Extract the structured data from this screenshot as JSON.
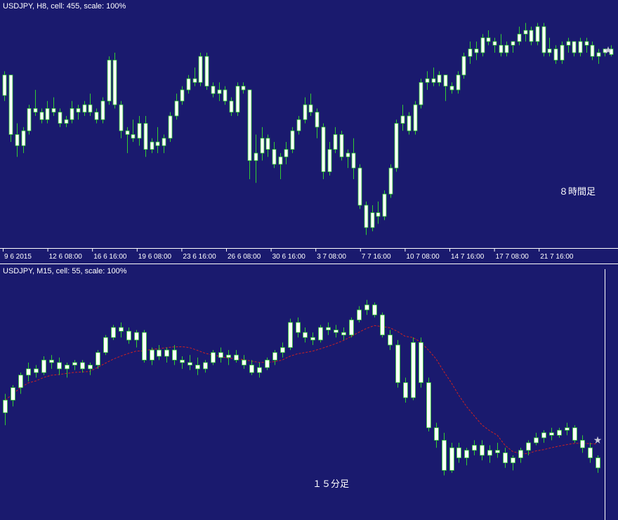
{
  "colors": {
    "background": "#1a1a6e",
    "bull_body": "#ffffff",
    "bear_body": "#ffffff",
    "wick": "#33cc33",
    "separator": "#ffffff",
    "ma_line": "#cc2222",
    "star": "#c8c8d8"
  },
  "icons": {
    "marker": "star-icon"
  },
  "chart_data": [
    {
      "type": "candlestick",
      "header": "USDJPY, H8, cell: 455, scale: 100%",
      "note": "８時間足",
      "x_ticks": [
        "9 6 2015",
        "12 6 08:00",
        "16 6 16:00",
        "19 6 08:00",
        "23 6 16:00",
        "26 6 08:00",
        "30 6 16:00",
        "3 7 08:00",
        "7 7 16:00",
        "10 7 08:00",
        "14 7 16:00",
        "17 7 08:00",
        "21 7 16:00"
      ],
      "ohlc": [
        [
          123.45,
          124.1,
          123.3,
          124.0
        ],
        [
          124.0,
          124.0,
          122.2,
          122.4
        ],
        [
          122.4,
          122.7,
          121.8,
          122.1
        ],
        [
          122.1,
          122.6,
          121.9,
          122.5
        ],
        [
          122.5,
          123.2,
          122.4,
          123.1
        ],
        [
          123.1,
          123.6,
          122.9,
          123.0
        ],
        [
          123.0,
          123.1,
          122.7,
          122.8
        ],
        [
          122.8,
          123.3,
          122.7,
          123.1
        ],
        [
          123.1,
          123.4,
          122.9,
          123.0
        ],
        [
          123.0,
          123.1,
          122.6,
          122.7
        ],
        [
          122.7,
          122.9,
          122.6,
          122.8
        ],
        [
          122.8,
          123.3,
          122.7,
          123.1
        ],
        [
          123.1,
          123.2,
          122.8,
          123.0
        ],
        [
          123.0,
          123.3,
          122.9,
          123.2
        ],
        [
          123.2,
          123.5,
          122.9,
          123.0
        ],
        [
          123.0,
          123.1,
          122.7,
          122.8
        ],
        [
          122.8,
          123.4,
          122.7,
          123.3
        ],
        [
          123.3,
          124.5,
          123.2,
          124.4
        ],
        [
          124.4,
          124.6,
          123.1,
          123.2
        ],
        [
          123.2,
          123.3,
          122.3,
          122.5
        ],
        [
          122.5,
          122.6,
          121.9,
          122.4
        ],
        [
          122.4,
          122.8,
          122.2,
          122.3
        ],
        [
          122.3,
          122.9,
          122.1,
          122.7
        ],
        [
          122.7,
          122.9,
          121.8,
          122.0
        ],
        [
          122.0,
          122.3,
          121.9,
          122.2
        ],
        [
          122.2,
          122.6,
          121.9,
          122.1
        ],
        [
          122.1,
          122.4,
          121.9,
          122.3
        ],
        [
          122.3,
          123.0,
          122.2,
          122.9
        ],
        [
          122.9,
          123.5,
          122.8,
          123.3
        ],
        [
          123.3,
          123.7,
          123.2,
          123.6
        ],
        [
          123.6,
          124.0,
          123.5,
          123.9
        ],
        [
          123.9,
          124.2,
          123.7,
          123.8
        ],
        [
          123.8,
          124.6,
          123.7,
          124.5
        ],
        [
          124.5,
          124.6,
          123.6,
          123.7
        ],
        [
          123.7,
          123.8,
          123.4,
          123.5
        ],
        [
          123.5,
          123.8,
          123.3,
          123.6
        ],
        [
          123.6,
          123.7,
          123.2,
          123.3
        ],
        [
          123.3,
          123.4,
          122.9,
          123.0
        ],
        [
          123.0,
          123.8,
          122.9,
          123.7
        ],
        [
          123.7,
          123.8,
          123.5,
          123.6
        ],
        [
          123.6,
          122.5,
          121.2,
          121.7
        ],
        [
          121.7,
          122.4,
          121.1,
          121.9
        ],
        [
          121.9,
          122.6,
          121.7,
          122.3
        ],
        [
          122.3,
          122.4,
          121.8,
          122.0
        ],
        [
          122.0,
          122.2,
          121.5,
          121.6
        ],
        [
          121.6,
          121.9,
          121.2,
          121.8
        ],
        [
          121.8,
          122.2,
          121.6,
          122.0
        ],
        [
          122.0,
          122.6,
          121.9,
          122.5
        ],
        [
          122.5,
          122.9,
          122.4,
          122.8
        ],
        [
          122.8,
          123.4,
          122.7,
          123.2
        ],
        [
          123.2,
          123.5,
          122.9,
          123.0
        ],
        [
          123.0,
          123.1,
          122.3,
          122.6
        ],
        [
          122.6,
          122.7,
          121.2,
          121.4
        ],
        [
          121.4,
          122.2,
          121.3,
          122.0
        ],
        [
          122.0,
          122.6,
          121.9,
          122.4
        ],
        [
          122.4,
          122.5,
          121.7,
          121.8
        ],
        [
          121.8,
          122.0,
          121.5,
          121.9
        ],
        [
          121.9,
          122.3,
          121.2,
          121.5
        ],
        [
          121.5,
          121.6,
          120.4,
          120.5
        ],
        [
          120.5,
          120.6,
          119.7,
          119.9
        ],
        [
          119.9,
          120.5,
          119.8,
          120.3
        ],
        [
          120.3,
          120.6,
          120.0,
          120.2
        ],
        [
          120.2,
          120.9,
          120.1,
          120.8
        ],
        [
          120.8,
          121.6,
          120.7,
          121.5
        ],
        [
          121.5,
          122.8,
          121.4,
          122.7
        ],
        [
          122.7,
          123.2,
          122.5,
          122.9
        ],
        [
          122.9,
          123.0,
          122.4,
          122.5
        ],
        [
          122.5,
          123.3,
          122.4,
          123.2
        ],
        [
          123.2,
          123.9,
          123.1,
          123.8
        ],
        [
          123.8,
          124.1,
          123.6,
          123.9
        ],
        [
          123.9,
          124.2,
          123.7,
          123.8
        ],
        [
          123.8,
          124.1,
          123.7,
          124.0
        ],
        [
          124.0,
          124.0,
          123.3,
          123.7
        ],
        [
          123.7,
          123.8,
          123.5,
          123.6
        ],
        [
          123.6,
          124.1,
          123.5,
          124.0
        ],
        [
          124.0,
          124.6,
          123.9,
          124.5
        ],
        [
          124.5,
          124.9,
          124.3,
          124.7
        ],
        [
          124.7,
          124.9,
          124.4,
          124.6
        ],
        [
          124.6,
          125.1,
          124.5,
          125.0
        ],
        [
          125.0,
          125.2,
          124.8,
          124.9
        ],
        [
          124.9,
          125.0,
          124.6,
          124.8
        ],
        [
          124.8,
          125.1,
          124.5,
          124.6
        ],
        [
          124.6,
          124.9,
          124.5,
          124.8
        ],
        [
          124.8,
          124.9,
          124.6,
          124.9
        ],
        [
          124.9,
          125.3,
          124.8,
          125.1
        ],
        [
          125.1,
          125.4,
          124.9,
          125.2
        ],
        [
          125.2,
          125.3,
          124.8,
          124.9
        ],
        [
          124.9,
          125.4,
          124.8,
          125.3
        ],
        [
          125.3,
          125.4,
          124.5,
          124.6
        ],
        [
          124.6,
          125.0,
          124.5,
          124.7
        ],
        [
          124.7,
          124.8,
          124.3,
          124.4
        ],
        [
          124.4,
          124.9,
          124.3,
          124.8
        ],
        [
          124.8,
          125.0,
          124.6,
          124.9
        ],
        [
          124.9,
          124.9,
          124.5,
          124.6
        ],
        [
          124.6,
          125.0,
          124.5,
          124.9
        ],
        [
          124.9,
          125.0,
          124.6,
          124.8
        ],
        [
          124.8,
          124.9,
          124.4,
          124.5
        ],
        [
          124.5,
          124.7,
          124.3,
          124.6
        ],
        [
          124.6,
          124.7,
          124.5,
          124.7
        ],
        [
          124.7,
          124.8,
          124.5,
          124.55
        ]
      ],
      "y_range": [
        119.5,
        125.6
      ]
    },
    {
      "type": "candlestick",
      "header": "USDJPY, M15, cell: 55, scale: 100%",
      "note": "１５分足",
      "ohlc": [
        [
          124.2,
          124.35,
          124.1,
          124.3
        ],
        [
          124.3,
          124.42,
          124.25,
          124.4
        ],
        [
          124.4,
          124.52,
          124.35,
          124.5
        ],
        [
          124.5,
          124.6,
          124.45,
          124.55
        ],
        [
          124.55,
          124.58,
          124.48,
          124.52
        ],
        [
          124.52,
          124.65,
          124.5,
          124.62
        ],
        [
          124.62,
          124.66,
          124.55,
          124.6
        ],
        [
          124.6,
          124.64,
          124.5,
          124.55
        ],
        [
          124.55,
          124.6,
          124.48,
          124.58
        ],
        [
          124.58,
          124.62,
          124.54,
          124.6
        ],
        [
          124.6,
          124.62,
          124.52,
          124.55
        ],
        [
          124.55,
          124.6,
          124.5,
          124.58
        ],
        [
          124.58,
          124.7,
          124.55,
          124.68
        ],
        [
          124.68,
          124.82,
          124.66,
          124.8
        ],
        [
          124.8,
          124.9,
          124.78,
          124.88
        ],
        [
          124.88,
          124.92,
          124.8,
          124.85
        ],
        [
          124.85,
          124.88,
          124.75,
          124.78
        ],
        [
          124.78,
          124.86,
          124.72,
          124.84
        ],
        [
          124.84,
          124.86,
          124.6,
          124.62
        ],
        [
          124.62,
          124.72,
          124.58,
          124.7
        ],
        [
          124.7,
          124.74,
          124.62,
          124.65
        ],
        [
          124.65,
          124.72,
          124.6,
          124.7
        ],
        [
          124.7,
          124.74,
          124.58,
          124.62
        ],
        [
          124.62,
          124.65,
          124.55,
          124.6
        ],
        [
          124.6,
          124.66,
          124.54,
          124.58
        ],
        [
          124.58,
          124.64,
          124.5,
          124.55
        ],
        [
          124.55,
          124.62,
          124.52,
          124.6
        ],
        [
          124.6,
          124.7,
          124.58,
          124.68
        ],
        [
          124.68,
          124.72,
          124.6,
          124.64
        ],
        [
          124.64,
          124.7,
          124.58,
          124.66
        ],
        [
          124.66,
          124.7,
          124.6,
          124.62
        ],
        [
          124.62,
          124.66,
          124.55,
          124.58
        ],
        [
          124.58,
          124.62,
          124.5,
          124.52
        ],
        [
          124.52,
          124.6,
          124.48,
          124.56
        ],
        [
          124.56,
          124.64,
          124.54,
          124.62
        ],
        [
          124.62,
          124.7,
          124.58,
          124.68
        ],
        [
          124.68,
          124.76,
          124.64,
          124.72
        ],
        [
          124.72,
          124.95,
          124.7,
          124.92
        ],
        [
          124.92,
          124.96,
          124.8,
          124.84
        ],
        [
          124.84,
          124.88,
          124.76,
          124.8
        ],
        [
          124.8,
          124.84,
          124.74,
          124.78
        ],
        [
          124.78,
          124.9,
          124.76,
          124.88
        ],
        [
          124.88,
          124.92,
          124.82,
          124.86
        ],
        [
          124.86,
          124.9,
          124.8,
          124.84
        ],
        [
          124.84,
          124.88,
          124.78,
          124.82
        ],
        [
          124.82,
          124.96,
          124.8,
          124.94
        ],
        [
          124.94,
          125.05,
          124.92,
          125.02
        ],
        [
          125.02,
          125.1,
          124.98,
          125.06
        ],
        [
          125.06,
          125.08,
          124.96,
          124.98
        ],
        [
          124.98,
          125.0,
          124.8,
          124.82
        ],
        [
          124.82,
          124.86,
          124.7,
          124.74
        ],
        [
          124.74,
          124.78,
          124.4,
          124.44
        ],
        [
          124.44,
          124.48,
          124.28,
          124.32
        ],
        [
          124.32,
          124.8,
          124.3,
          124.76
        ],
        [
          124.76,
          124.8,
          124.4,
          124.44
        ],
        [
          124.44,
          124.48,
          124.05,
          124.08
        ],
        [
          124.08,
          124.12,
          123.92,
          123.98
        ],
        [
          123.98,
          124.04,
          123.7,
          123.74
        ],
        [
          123.74,
          123.96,
          123.72,
          123.92
        ],
        [
          123.92,
          123.96,
          123.8,
          123.84
        ],
        [
          123.84,
          123.92,
          123.78,
          123.9
        ],
        [
          123.9,
          123.98,
          123.86,
          123.94
        ],
        [
          123.94,
          123.98,
          123.82,
          123.86
        ],
        [
          123.86,
          123.94,
          123.8,
          123.9
        ],
        [
          123.9,
          123.96,
          123.84,
          123.88
        ],
        [
          123.88,
          123.92,
          123.76,
          123.8
        ],
        [
          123.8,
          123.86,
          123.74,
          123.84
        ],
        [
          123.84,
          123.92,
          123.8,
          123.9
        ],
        [
          123.9,
          123.98,
          123.86,
          123.96
        ],
        [
          123.96,
          124.04,
          123.94,
          124.0
        ],
        [
          124.0,
          124.06,
          123.96,
          124.04
        ],
        [
          124.04,
          124.08,
          123.98,
          124.02
        ],
        [
          124.02,
          124.08,
          124.0,
          124.06
        ],
        [
          124.06,
          124.12,
          124.02,
          124.08
        ],
        [
          124.08,
          124.1,
          123.96,
          123.98
        ],
        [
          123.98,
          124.02,
          123.88,
          123.92
        ],
        [
          123.92,
          123.96,
          123.8,
          123.84
        ],
        [
          123.84,
          123.86,
          123.72,
          123.76
        ]
      ],
      "y_range": [
        123.4,
        125.25
      ]
    }
  ]
}
